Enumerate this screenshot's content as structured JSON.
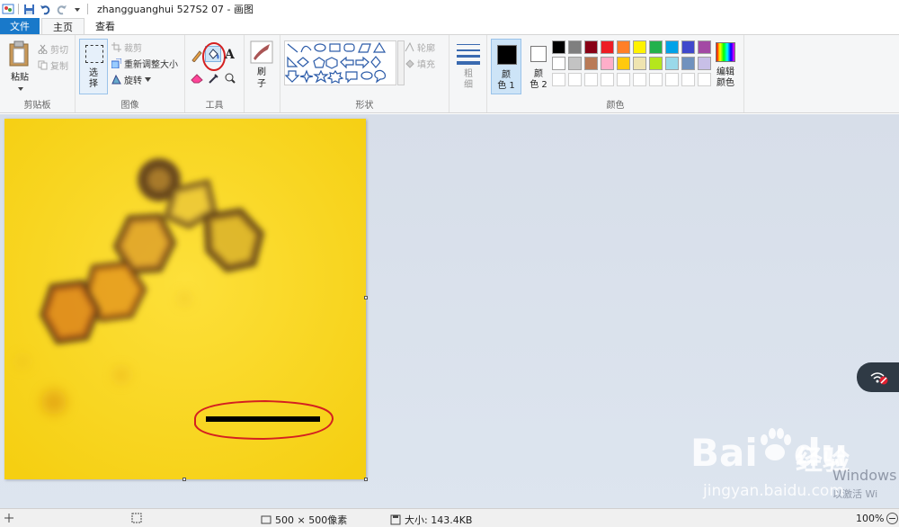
{
  "window": {
    "title": "zhangguanghui 527S2 07 - 画图"
  },
  "tabs": [
    {
      "label": "文件"
    },
    {
      "label": "主页"
    },
    {
      "label": "查看"
    }
  ],
  "ribbon": {
    "clipboard": {
      "paste": "粘贴",
      "cut": "剪切",
      "copy": "复制",
      "label": "剪贴板"
    },
    "image": {
      "select": "选",
      "select2": "择",
      "crop": "裁剪",
      "resize": "重新调整大小",
      "rotate": "旋转",
      "label": "图像"
    },
    "tools": {
      "label": "工具",
      "text_glyph": "A"
    },
    "brushes": {
      "label": "刷",
      "label2": "子"
    },
    "shapes": {
      "outline": "轮廓",
      "fill": "填充",
      "label": "形状"
    },
    "size": {
      "label": "粗",
      "label2": "细"
    },
    "colors": {
      "color1": "颜",
      "color1b": "色 1",
      "color2": "颜",
      "color2b": "色 2",
      "edit": "编辑",
      "edit2": "颜色",
      "label": "颜色",
      "primary": "#000000",
      "secondary": "#ffffff",
      "palette_row1": [
        "#000000",
        "#7f7f7f",
        "#880015",
        "#ed1c24",
        "#ff7f27",
        "#fff200",
        "#22b14c",
        "#00a2e8",
        "#3f48cc",
        "#a349a4"
      ],
      "palette_row2": [
        "#ffffff",
        "#c3c3c3",
        "#b97a57",
        "#ffaec9",
        "#ffc90e",
        "#efe4b0",
        "#b5e61d",
        "#99d9ea",
        "#7092be",
        "#c8bfe7"
      ]
    }
  },
  "status": {
    "dimensions": "500 × 500像素",
    "size": "大小: 143.4KB",
    "zoom": "100%"
  },
  "watermark": {
    "brand": "Bai",
    "brand2": "du",
    "brand_cn": "经验",
    "url": "jingyan.baidu.com",
    "windows": "Windows",
    "windows_sub": "以激活 Wi"
  },
  "image_colors": {
    "background": "#f8d41a",
    "crystal": "#5a3a1a",
    "scale_bar": "#000000",
    "annotation": "#d42020"
  }
}
